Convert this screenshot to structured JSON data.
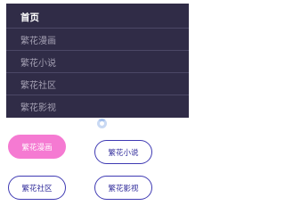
{
  "menu": {
    "items": [
      {
        "label": "首页",
        "active": true
      },
      {
        "label": "繁花漫画",
        "active": false
      },
      {
        "label": "繁花小说",
        "active": false
      },
      {
        "label": "繁花社区",
        "active": false
      },
      {
        "label": "繁花影视",
        "active": false
      }
    ]
  },
  "tiles": [
    {
      "label": "繁花漫画",
      "active": true
    },
    {
      "label": "繁花小说",
      "active": false
    },
    {
      "label": "繁花社区",
      "active": false
    },
    {
      "label": "繁花影视",
      "active": false
    }
  ],
  "colors": {
    "menu_background": "#302c47",
    "active_tile": "#f57ad2",
    "tile_border": "#3f3ab3"
  },
  "icons": {
    "loading": "loading-spinner-icon"
  }
}
